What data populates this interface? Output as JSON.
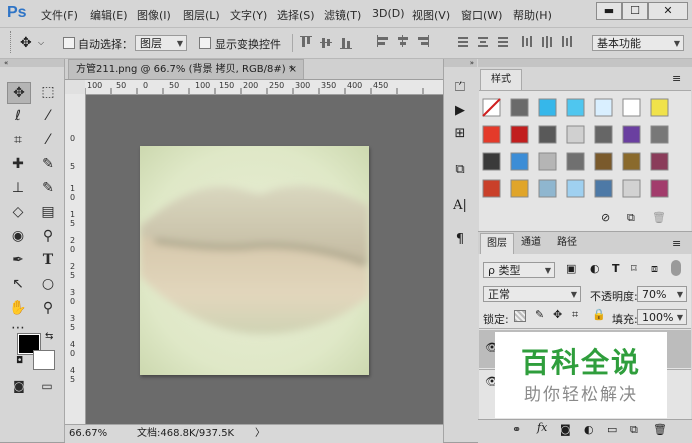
{
  "app": {
    "logo": "Ps"
  },
  "menu": [
    {
      "label": "文件(F)"
    },
    {
      "label": "编辑(E)"
    },
    {
      "label": "图像(I)"
    },
    {
      "label": "图层(L)"
    },
    {
      "label": "文字(Y)"
    },
    {
      "label": "选择(S)"
    },
    {
      "label": "滤镜(T)"
    },
    {
      "label": "3D(D)"
    },
    {
      "label": "视图(V)"
    },
    {
      "label": "窗口(W)"
    },
    {
      "label": "帮助(H)"
    }
  ],
  "window_buttons": {
    "minimize": "▬",
    "maximize": "☐",
    "close": "✕"
  },
  "options": {
    "auto_select_label": "自动选择：",
    "auto_select_value": "图层",
    "show_transform_label": "显示变换控件",
    "workspace": "基本功能"
  },
  "document": {
    "tab_title": "方管211.png @ 66.7% (背景 拷贝, RGB/8#) *",
    "tab_close": "×",
    "ruler_top": [
      "100",
      "50",
      "0",
      "50",
      "100",
      "150",
      "200",
      "250",
      "300",
      "350",
      "400",
      "450"
    ],
    "ruler_left": [
      "0",
      "5",
      "1",
      "0",
      "1",
      "5",
      "2",
      "0",
      "2",
      "5",
      "3",
      "0",
      "3",
      "5",
      "4",
      "0",
      "4",
      "5"
    ],
    "zoom": "66.67%",
    "doc_info": "文档:468.8K/937.5K",
    "status_arrow": "〉"
  },
  "styles_panel": {
    "title": "样式",
    "swatch_colors": [
      "#ffffff",
      "#6a6a6a",
      "#36b7ea",
      "#4fc6ef",
      "#d9efff",
      "#ffffff",
      "#f0e24a",
      "#e43a2a",
      "#c21e1e",
      "#595959",
      "#d0d0d0",
      "#666666",
      "#6a3fa0",
      "#787878",
      "#3a3a3a",
      "#3c8dd6",
      "#b5b5b5",
      "#707070",
      "#7a5a2c",
      "#8a6a2c",
      "#8a3c5a",
      "#c9402a",
      "#e0a52a",
      "#8fb6cf",
      "#9fd0f0",
      "#4d79a6",
      "#d2d2d2",
      "#a23c6c"
    ]
  },
  "layers_panel": {
    "tabs": [
      "图层",
      "通道",
      "路径"
    ],
    "filter_label": "ρ 类型",
    "blend_mode": "正常",
    "opacity_label": "不透明度:",
    "opacity_value": "70%",
    "lock_label": "锁定:",
    "fill_label": "填充:",
    "fill_value": "100%"
  },
  "watermark": {
    "line1": "百科全说",
    "line2": "助你轻松解决"
  }
}
